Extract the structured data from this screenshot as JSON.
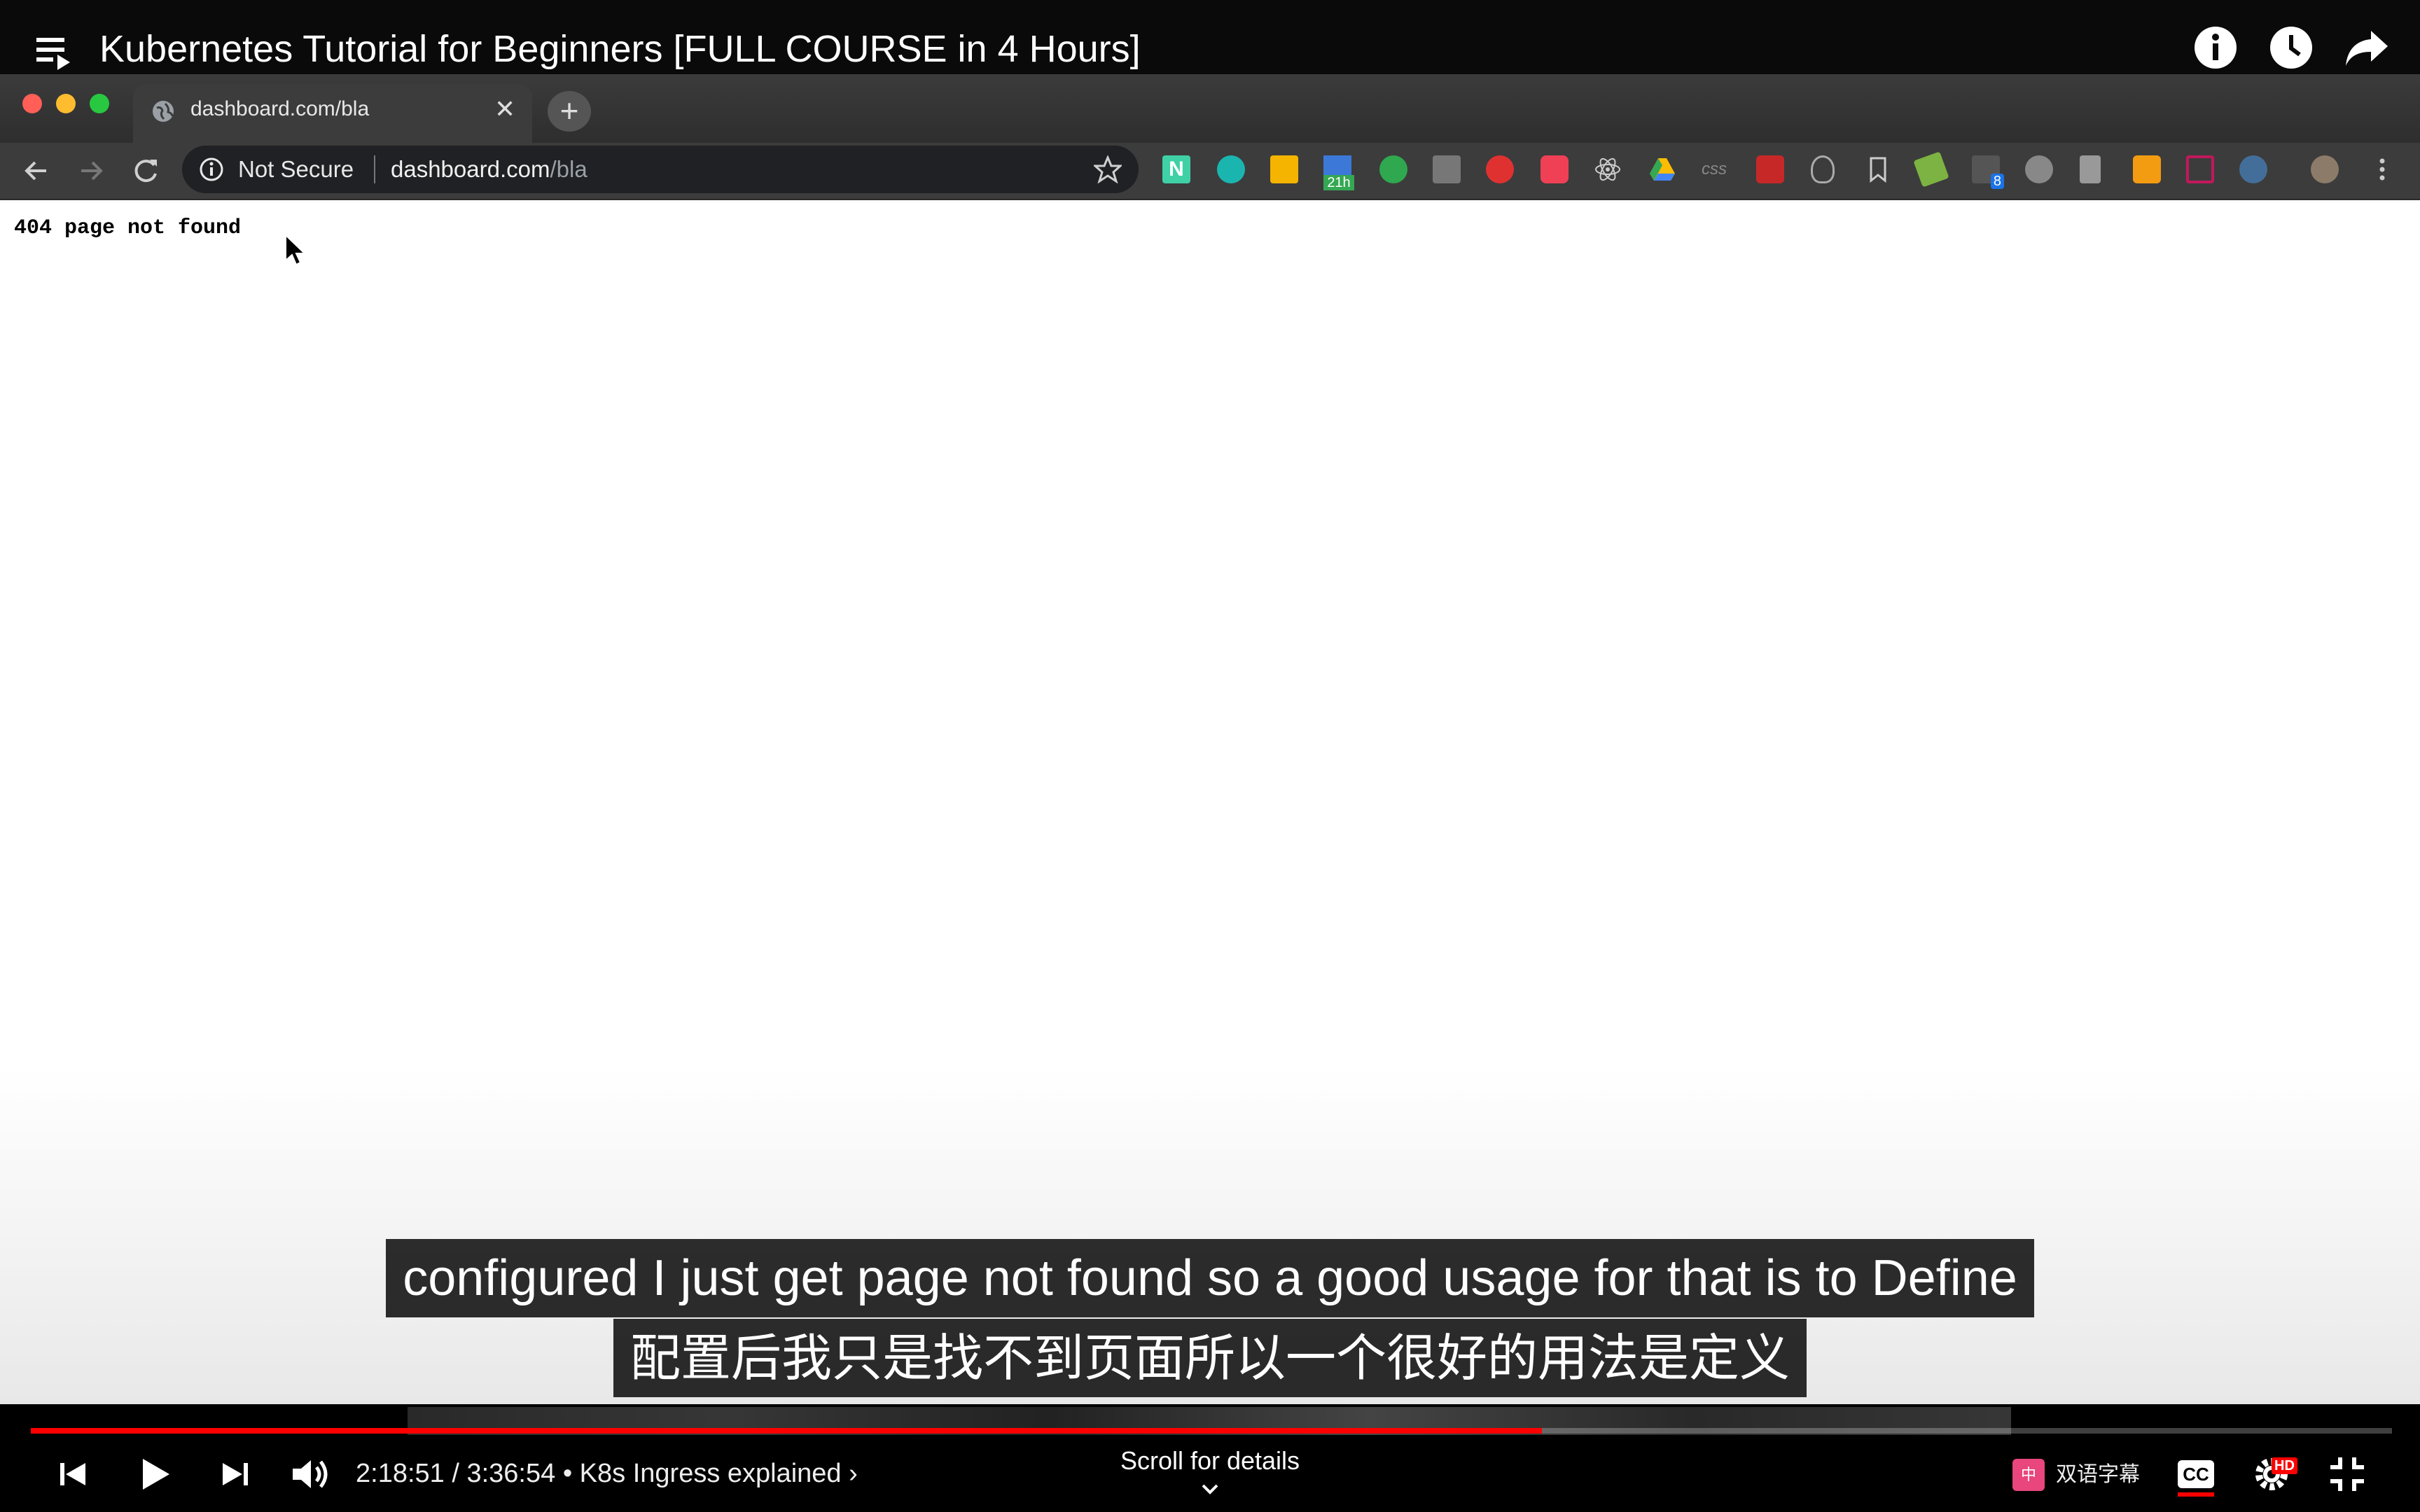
{
  "youtube": {
    "video_title": "Kubernetes Tutorial for Beginners [FULL COURSE in 4 Hours]",
    "top_actions": [
      "info-icon",
      "watch-later-icon",
      "share-icon"
    ]
  },
  "browser": {
    "tab_title": "dashboard.com/bla",
    "security_label": "Not Secure",
    "url_host": "dashboard.com",
    "url_path": "/bla",
    "extension_badges": {
      "calendar_date": "21h",
      "count": "8"
    }
  },
  "page": {
    "body_text": "404 page not found"
  },
  "captions": {
    "english": "configured I just get page not found so a good usage for that is to Define",
    "chinese": "配置后我只是找不到页面所以一个很好的用法是定义"
  },
  "player": {
    "current_time": "2:18:51",
    "duration": "3:36:54",
    "time_display": "2:18:51 / 3:36:54",
    "chapter": "• K8s Ingress explained ›",
    "scroll_hint": "Scroll for details",
    "dual_subtitle_label": "双语字幕",
    "cc_label": "CC",
    "hd_badge": "HD",
    "progress_fraction": 0.64
  },
  "colors": {
    "progress": "#ff0000",
    "chrome_dark": "#3c3c3c",
    "traffic_close": "#ff5f57",
    "traffic_min": "#febc2e",
    "traffic_max": "#28c840"
  }
}
